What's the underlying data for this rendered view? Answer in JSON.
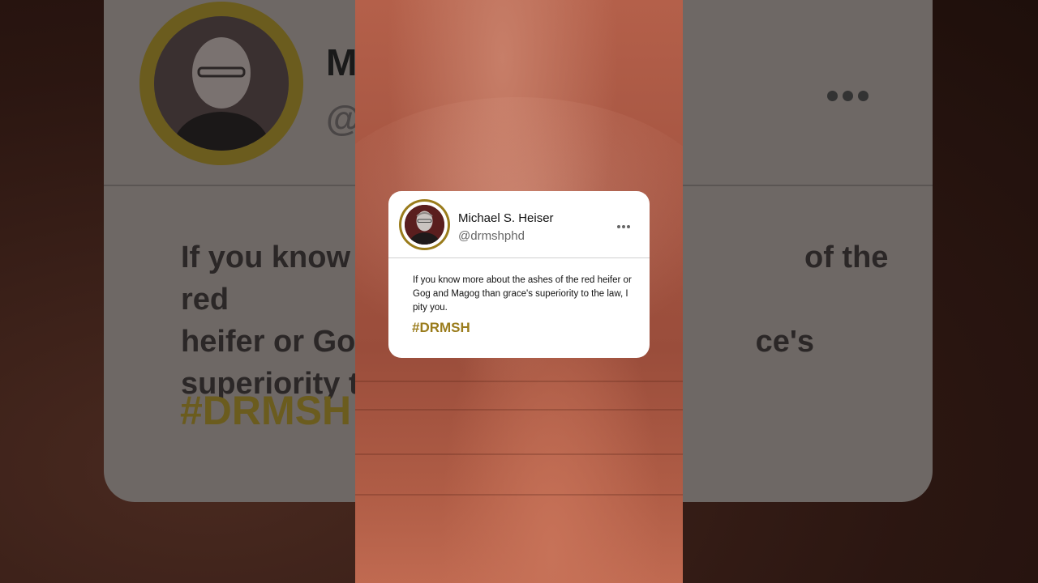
{
  "background": {
    "text_fragments": [
      "M",
      "@",
      "If you know",
      "of the red",
      "heifer or Gog",
      "ce's",
      "superiority t",
      "#DRMSH"
    ]
  },
  "tweet": {
    "author_name": "Michael S. Heiser",
    "author_handle": "@drmshphd",
    "body": "If you know more about the ashes of the red heifer or Gog and Magog than grace's superiority to the law, I pity you.",
    "hashtag": "#DRMSH",
    "more_icon": "more-horizontal-icon"
  },
  "colors": {
    "accent_gold": "#9a7c1c",
    "card_bg": "#ffffff",
    "strip_rock": "#a45441"
  }
}
